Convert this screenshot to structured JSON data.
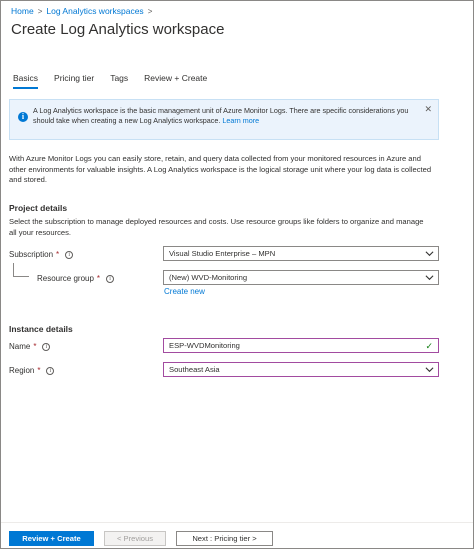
{
  "breadcrumb": {
    "home": "Home",
    "parent": "Log Analytics workspaces",
    "separator": ">"
  },
  "page_title": "Create Log Analytics workspace",
  "tabs": [
    {
      "label": "Basics",
      "active": true
    },
    {
      "label": "Pricing tier",
      "active": false
    },
    {
      "label": "Tags",
      "active": false
    },
    {
      "label": "Review + Create",
      "active": false
    }
  ],
  "info_banner": {
    "text": "A Log Analytics workspace is the basic management unit of Azure Monitor Logs. There are specific considerations you should take when creating a new Log Analytics workspace.",
    "link": "Learn more",
    "icon": "info-icon",
    "close": "✕"
  },
  "description": "With Azure Monitor Logs you can easily store, retain, and query data collected from your monitored resources in Azure and other environments for valuable insights. A Log Analytics workspace is the logical storage unit where your log data is collected and stored.",
  "project_details": {
    "heading": "Project details",
    "text": "Select the subscription to manage deployed resources and costs. Use resource groups like folders to organize and manage all your resources.",
    "subscription_label": "Subscription",
    "subscription_value": "Visual Studio Enterprise – MPN",
    "resource_group_label": "Resource group",
    "resource_group_value": "(New) WVD-Monitoring",
    "create_new": "Create new"
  },
  "instance_details": {
    "heading": "Instance details",
    "name_label": "Name",
    "name_value": "ESP-WVDMonitoring",
    "region_label": "Region",
    "region_value": "Southeast Asia"
  },
  "required_marker": "*",
  "footer": {
    "review_create": "Review + Create",
    "previous": "< Previous",
    "next": "Next : Pricing tier >"
  },
  "colors": {
    "accent": "#0078d4",
    "required": "#a4262c",
    "focus_border": "#a24ba0",
    "valid_check": "#107c10"
  }
}
